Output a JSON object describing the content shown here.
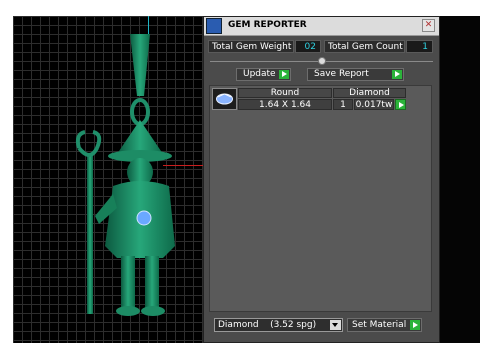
{
  "window": {
    "title": "GEM REPORTER"
  },
  "totals": {
    "weight_label": "Total Gem Weight",
    "weight_value": "02",
    "count_label": "Total Gem Count",
    "count_value": "1"
  },
  "toolbar": {
    "update_label": "Update",
    "save_report_label": "Save Report"
  },
  "gem_table": {
    "headers": [
      "Round",
      "Diamond"
    ],
    "rows": [
      {
        "size": "1.64 X 1.64",
        "count": "1",
        "weight": "0.017tw"
      }
    ]
  },
  "material": {
    "selected": "Diamond    (3.52 spg)",
    "set_label": "Set Material"
  },
  "colors": {
    "model": "#1f8f6a",
    "accent_cyan": "#2fd0e0",
    "go_green": "#2bb33a",
    "gem_blue": "#6aa8ff"
  },
  "icons": [
    "app-icon",
    "close-icon",
    "go-arrow-icon",
    "gem-thumbnail-icon",
    "dropdown-arrow-icon"
  ]
}
